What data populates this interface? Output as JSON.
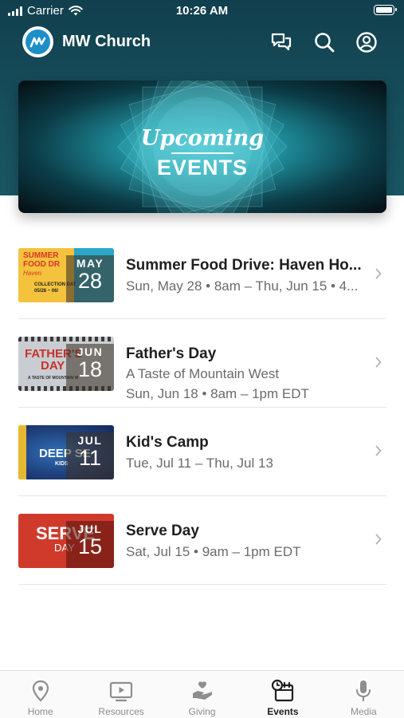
{
  "status_bar": {
    "carrier": "Carrier",
    "time": "10:26 AM"
  },
  "app": {
    "title": "MW Church"
  },
  "banner": {
    "line1": "Upcoming",
    "line2": "EVENTS"
  },
  "events": [
    {
      "title": "Summer Food Drive: Haven Ho...",
      "lines": [
        "Sun, May 28 • 8am – Thu, Jun 15 • 4..."
      ],
      "month": "MAY",
      "day": "28",
      "thumb_text": [
        "SUMMER",
        "FOOD DR",
        "Haven",
        "COLLECTION DAT",
        "05/28 ~ 06/"
      ],
      "thumb_color": "#2aa7c7"
    },
    {
      "title": "Father's Day",
      "lines": [
        "A Taste of Mountain West",
        "Sun, Jun 18 • 8am – 1pm EDT"
      ],
      "month": "JUN",
      "day": "18",
      "thumb_text": [
        "FATHER'S",
        "DAY",
        "A TASTE OF MOUNTAIN W"
      ],
      "thumb_color": "#c9ccd0"
    },
    {
      "title": "Kid's Camp",
      "lines": [
        "Tue, Jul 11 – Thu, Jul 13"
      ],
      "month": "JUL",
      "day": "11",
      "thumb_text": [
        "DEEP SE",
        "KIDS"
      ],
      "thumb_color": "#1f3f7a"
    },
    {
      "title": "Serve Day",
      "lines": [
        "Sat, Jul 15 • 9am – 1pm EDT"
      ],
      "month": "JUL",
      "day": "15",
      "thumb_text": [
        "SERVE",
        "DAY"
      ],
      "thumb_color": "#cf3a2a"
    }
  ],
  "tabs": [
    {
      "label": "Home",
      "icon": "location-pin-icon",
      "active": false
    },
    {
      "label": "Resources",
      "icon": "tv-play-icon",
      "active": false
    },
    {
      "label": "Giving",
      "icon": "giving-hand-heart-icon",
      "active": false
    },
    {
      "label": "Events",
      "icon": "calendar-clock-icon",
      "active": true
    },
    {
      "label": "Media",
      "icon": "microphone-icon",
      "active": false
    }
  ],
  "colors": {
    "header": "#17505d",
    "accent": "#1d8fc7",
    "banner_glow": "#46c3d0",
    "tab_active": "#1f1f1f",
    "tab_inactive": "#8e8e8e"
  }
}
